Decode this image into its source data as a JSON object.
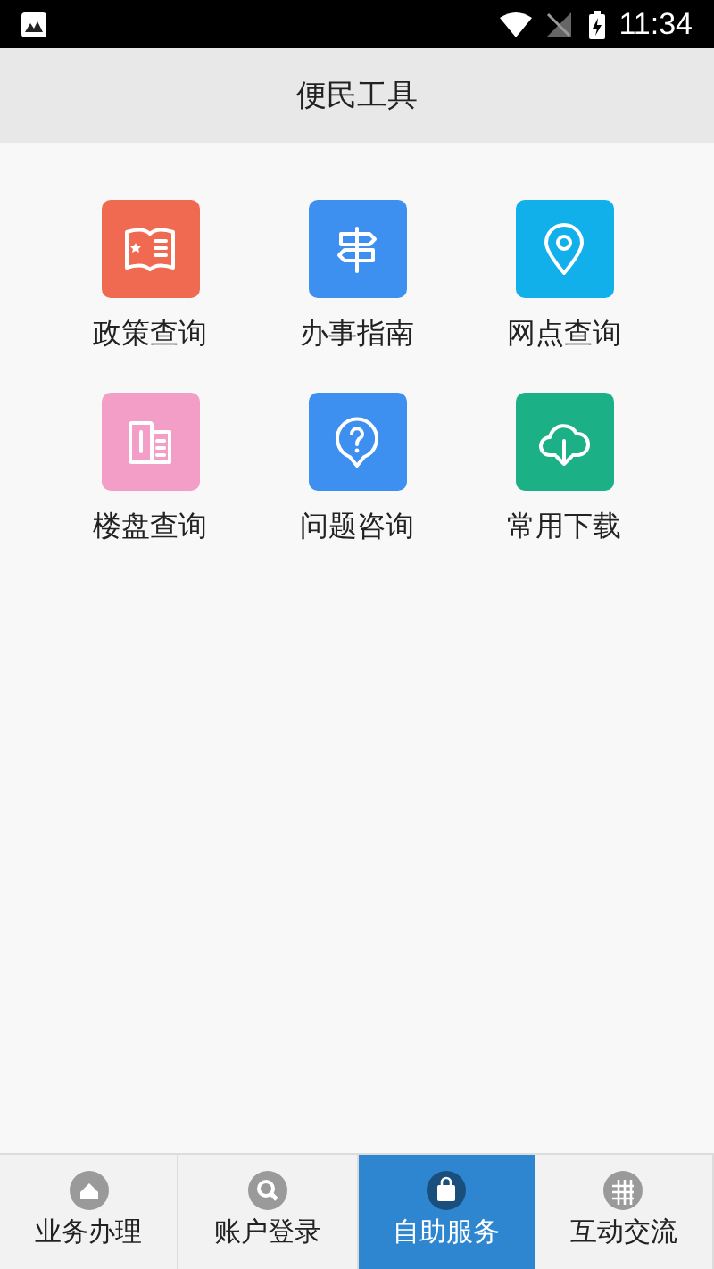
{
  "status_bar": {
    "time": "11:34"
  },
  "header": {
    "title": "便民工具"
  },
  "tools": [
    {
      "label": "政策查询",
      "color": "#ef6a50"
    },
    {
      "label": "办事指南",
      "color": "#3d8ff0"
    },
    {
      "label": "网点查询",
      "color": "#12b0ea"
    },
    {
      "label": "楼盘查询",
      "color": "#f29ec6"
    },
    {
      "label": "问题咨询",
      "color": "#3d8ff0"
    },
    {
      "label": "常用下载",
      "color": "#1cb087"
    }
  ],
  "tab_bar": [
    {
      "label": "业务办理",
      "selected": false
    },
    {
      "label": "账户登录",
      "selected": false
    },
    {
      "label": "自助服务",
      "selected": true
    },
    {
      "label": "互动交流",
      "selected": false
    }
  ]
}
